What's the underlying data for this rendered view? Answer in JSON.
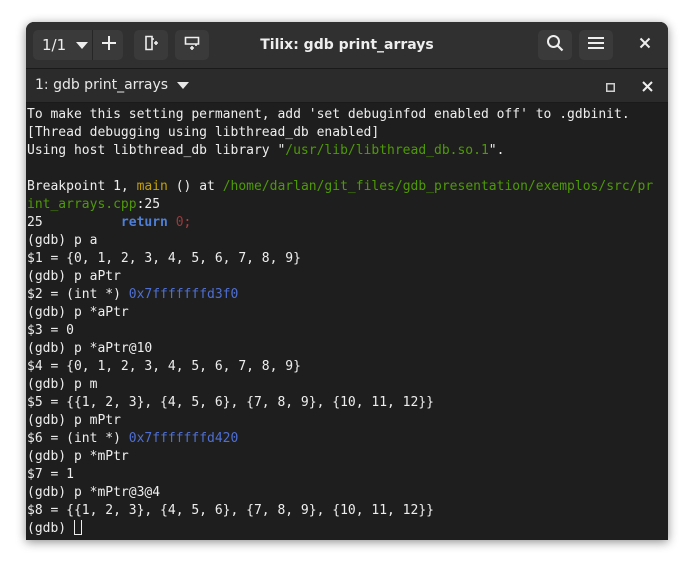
{
  "window": {
    "title": "Tilix: gdb print_arrays"
  },
  "headerbar": {
    "session_count": "1/1"
  },
  "tab": {
    "title": "1: gdb print_arrays"
  },
  "terminal": {
    "l1": "To make this setting permanent, add 'set debuginfod enabled off' to .gdbinit.",
    "l2": "[Thread debugging using libthread_db enabled]",
    "l3a": "Using host libthread_db library \"",
    "l3b": "/usr/lib/libthread_db.so.1",
    "l3c": "\".",
    "l5a": "Breakpoint 1, ",
    "l5b": "main",
    "l5c": " () at ",
    "l5d": "/home/darlan/git_files/gdb_presentation/exemplos/src/pr",
    "l6a": "int_arrays.cpp",
    "l6b": ":25",
    "l7a": "25          ",
    "l7b": "return",
    "l7c": " ",
    "l7d": "0",
    "l7e": ";",
    "l8": "(gdb) p a",
    "l9": "$1 = {0, 1, 2, 3, 4, 5, 6, 7, 8, 9}",
    "l10": "(gdb) p aPtr",
    "l11a": "$2 = (int *) ",
    "l11b": "0x7fffffffd3f0",
    "l12": "(gdb) p *aPtr",
    "l13": "$3 = 0",
    "l14": "(gdb) p *aPtr@10",
    "l15": "$4 = {0, 1, 2, 3, 4, 5, 6, 7, 8, 9}",
    "l16": "(gdb) p m",
    "l17": "$5 = {{1, 2, 3}, {4, 5, 6}, {7, 8, 9}, {10, 11, 12}}",
    "l18": "(gdb) p mPtr",
    "l19a": "$6 = (int *) ",
    "l19b": "0x7fffffffd420",
    "l20": "(gdb) p *mPtr",
    "l21": "$7 = 1",
    "l22": "(gdb) p *mPtr@3@4",
    "l23": "$8 = {{1, 2, 3}, {4, 5, 6}, {7, 8, 9}, {10, 11, 12}}",
    "l24": "(gdb) "
  },
  "colors": {
    "path": "#4e9a06",
    "function": "#c4a000",
    "keyword": "#4f7fd6",
    "address": "#4f6fd0",
    "background": "#1e1e1e"
  },
  "icons": {
    "session_caret": "chevron-down-icon",
    "add": "plus-icon",
    "add_right": "split-right-icon",
    "add_down": "split-down-icon",
    "search": "search-icon",
    "menu": "hamburger-menu-icon",
    "close": "close-icon",
    "maximize": "maximize-icon"
  }
}
